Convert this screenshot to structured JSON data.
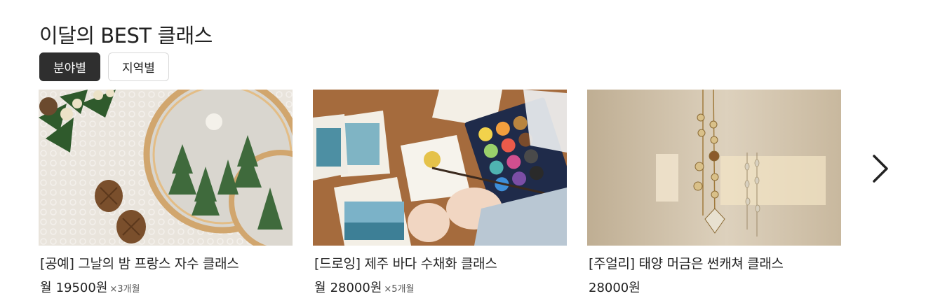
{
  "section": {
    "title": "이달의 BEST 클래스"
  },
  "tabs": [
    {
      "label": "분야별",
      "active": true
    },
    {
      "label": "지역별",
      "active": false
    }
  ],
  "cards": [
    {
      "name": "[공예] 그날의 밤 프랑스 자수 클래스",
      "price_prefix": "월",
      "price": "19500",
      "currency": "원",
      "installment": "×3개월",
      "image": "embroidery-hoop-photo"
    },
    {
      "name": "[드로잉] 제주 바다 수채화 클래스",
      "price_prefix": "월",
      "price": "28000",
      "currency": "원",
      "installment": "×5개월",
      "image": "watercolor-painting-photo"
    },
    {
      "name": "[주얼리] 태양 머금은 썬캐쳐 클래스",
      "price_prefix": "",
      "price": "28000",
      "currency": "원",
      "installment": "",
      "image": "suncatcher-photo"
    }
  ],
  "nav": {
    "next_icon": "chevron-right-icon"
  }
}
